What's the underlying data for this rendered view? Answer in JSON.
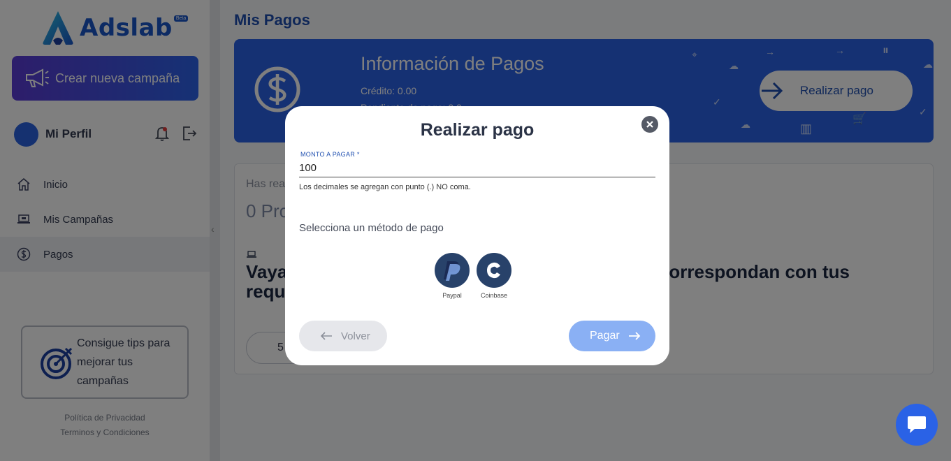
{
  "sidebar": {
    "logo_text": "Adslab",
    "logo_badge": "Beta",
    "new_campaign_label": "Crear nueva campaña",
    "profile_name": "Mi Perfil",
    "nav": [
      {
        "label": "Inicio",
        "icon": "home-icon"
      },
      {
        "label": "Mis Campañas",
        "icon": "laptop-icon"
      },
      {
        "label": "Pagos",
        "icon": "dollar-icon"
      }
    ],
    "active_nav": "Pagos",
    "tips_text": "Consigue tips para mejorar tus campañas",
    "privacy_link": "Política de Privacidad",
    "terms_link": "Terminos y Condiciones"
  },
  "main": {
    "page_title": "Mis Pagos",
    "banner": {
      "title": "Información de Pagos",
      "credit": "Crédito: 0.00",
      "pending": "Pendiente de pago: 0.0",
      "pay_button_label": "Realizar pago"
    },
    "card": {
      "sub": "Has realizado",
      "big": "0 Proyectos",
      "headline": "Vaya, aún no hemos encontrado proyectos que correspondan con tus requisitos",
      "pill_value": "5"
    }
  },
  "modal": {
    "title": "Realizar pago",
    "amount_label": "MONTO A PAGAR *",
    "amount_value": "100",
    "amount_hint": "Los decimales se agregan con punto (.) NO coma.",
    "method_title": "Selecciona un método de pago",
    "methods": [
      {
        "name": "Paypal",
        "icon": "paypal-icon"
      },
      {
        "name": "Coinbase",
        "icon": "coinbase-icon"
      }
    ],
    "back_label": "Volver",
    "pay_label": "Pagar"
  },
  "colors": {
    "primary": "#2a62e6",
    "dark_text": "#2b3346",
    "pay_button_disabled": "#8ab0f4"
  }
}
